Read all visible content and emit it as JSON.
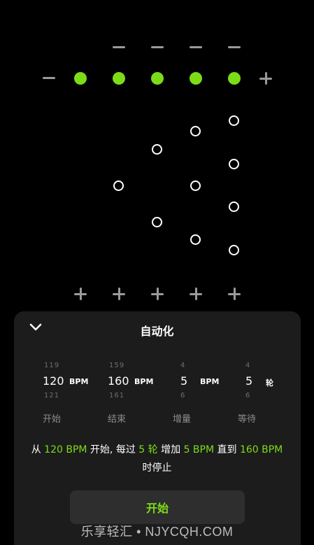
{
  "panel": {
    "title": "自动化",
    "pickers": [
      {
        "above": "119",
        "value": "120",
        "unit": "BPM",
        "below": "121",
        "label": "开始"
      },
      {
        "above": "159",
        "value": "160",
        "unit": "BPM",
        "below": "161",
        "label": "结束"
      },
      {
        "above": "4",
        "value": "5",
        "unit": "BPM",
        "below": "6",
        "label": "增量"
      },
      {
        "above": "4",
        "value": "5",
        "unit": "轮",
        "below": "6",
        "label": "等待"
      }
    ],
    "description": {
      "p1": "从 ",
      "v1": "120 BPM",
      "p2": " 开始, 每过 ",
      "v2": "5 轮",
      "p3": " 增加 ",
      "v3": "5 BPM",
      "p4": " 直到 ",
      "v4": "160 BPM",
      "p5": " 时停止"
    },
    "start_label": "开始"
  },
  "watermark": "乐享轻汇 • NJYCQH.COM",
  "colors": {
    "accent": "#7ddc18",
    "panel": "#1c1c1c",
    "button": "#2e2e2e"
  }
}
